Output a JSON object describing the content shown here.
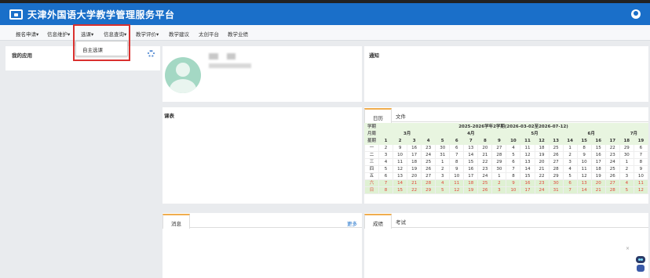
{
  "header": {
    "title": "天津外国语大学教学管理服务平台"
  },
  "nav": {
    "items": [
      "报名申请▾",
      "信息维护▾",
      "选课▾",
      "信息查询▾",
      "教学评价▾",
      "教学建议",
      "太创平台",
      "教学业绩"
    ]
  },
  "dropdown": {
    "item": "自主选课"
  },
  "apps": {
    "title": "我的应用"
  },
  "notice": {
    "title": "通知"
  },
  "course": {
    "title": "课表"
  },
  "message": {
    "tab": "消息",
    "more": "更多"
  },
  "calendar": {
    "tabs": [
      "日历",
      "文件"
    ],
    "corner": {
      "top": "学期",
      "mid": "月周",
      "bottom": "星期"
    },
    "term": "2025-2026学年2学期(2026-03-02至2026-07-12)",
    "months": [
      "3月",
      "4月",
      "5月",
      "6月",
      "7月"
    ],
    "weeks": [
      "1",
      "2",
      "3",
      "4",
      "5",
      "6",
      "7",
      "8",
      "9",
      "10",
      "11",
      "12",
      "13",
      "14",
      "15",
      "16",
      "17",
      "18",
      "19"
    ],
    "rows": [
      {
        "day": "一",
        "cells": [
          "2",
          "9",
          "16",
          "23",
          "30",
          "6",
          "13",
          "20",
          "27",
          "4",
          "11",
          "18",
          "25",
          "1",
          "8",
          "15",
          "22",
          "29",
          "6"
        ]
      },
      {
        "day": "二",
        "cells": [
          "3",
          "10",
          "17",
          "24",
          "31",
          "7",
          "14",
          "21",
          "28",
          "5",
          "12",
          "19",
          "26",
          "2",
          "9",
          "16",
          "23",
          "30",
          "7"
        ]
      },
      {
        "day": "三",
        "cells": [
          "4",
          "11",
          "18",
          "25",
          "1",
          "8",
          "15",
          "22",
          "29",
          "6",
          "13",
          "20",
          "27",
          "3",
          "10",
          "17",
          "24",
          "1",
          "8"
        ]
      },
      {
        "day": "四",
        "cells": [
          "5",
          "12",
          "19",
          "26",
          "2",
          "9",
          "16",
          "23",
          "30",
          "7",
          "14",
          "21",
          "28",
          "4",
          "11",
          "18",
          "25",
          "2",
          "9"
        ]
      },
      {
        "day": "五",
        "cells": [
          "6",
          "13",
          "20",
          "27",
          "3",
          "10",
          "17",
          "24",
          "1",
          "8",
          "15",
          "22",
          "29",
          "5",
          "12",
          "19",
          "26",
          "3",
          "10"
        ]
      },
      {
        "day": "六",
        "cells": [
          "7",
          "14",
          "21",
          "28",
          "4",
          "11",
          "18",
          "25",
          "2",
          "9",
          "16",
          "23",
          "30",
          "6",
          "13",
          "20",
          "27",
          "4",
          "11"
        ]
      },
      {
        "day": "日",
        "cells": [
          "8",
          "15",
          "22",
          "29",
          "5",
          "12",
          "19",
          "26",
          "3",
          "10",
          "17",
          "24",
          "31",
          "7",
          "14",
          "21",
          "28",
          "5",
          "12"
        ]
      }
    ]
  },
  "grades": {
    "tabs": [
      "成绩",
      "考试"
    ]
  },
  "close": "×"
}
